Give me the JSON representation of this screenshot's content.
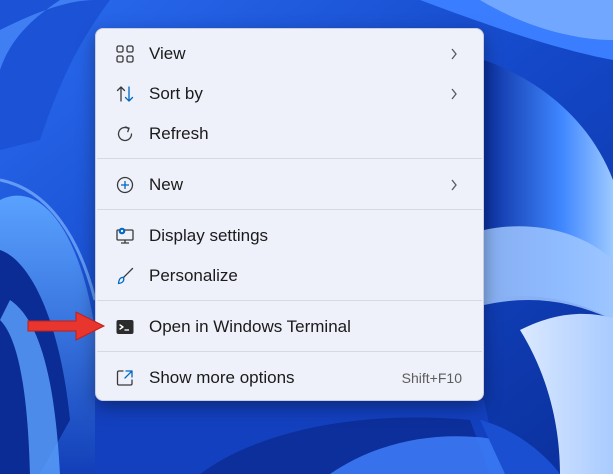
{
  "context_menu": {
    "items": [
      {
        "label": "View",
        "icon": "grid-icon",
        "submenu": true
      },
      {
        "label": "Sort by",
        "icon": "sort-icon",
        "submenu": true
      },
      {
        "label": "Refresh",
        "icon": "refresh-icon",
        "submenu": false
      },
      {
        "label": "New",
        "icon": "plus-circle-icon",
        "submenu": true
      },
      {
        "label": "Display settings",
        "icon": "display-settings-icon",
        "submenu": false
      },
      {
        "label": "Personalize",
        "icon": "brush-icon",
        "submenu": false
      },
      {
        "label": "Open in Windows Terminal",
        "icon": "terminal-icon",
        "submenu": false
      },
      {
        "label": "Show more options",
        "icon": "show-more-options-icon",
        "submenu": false,
        "shortcut": "Shift+F10"
      }
    ]
  },
  "annotation": {
    "arrow_color": "#e8352e",
    "points_to": "Open in Windows Terminal"
  },
  "colors": {
    "wallpaper_blue": "#1f56d8",
    "menu_background": "#eef0fa",
    "accent": "#0067c0"
  }
}
